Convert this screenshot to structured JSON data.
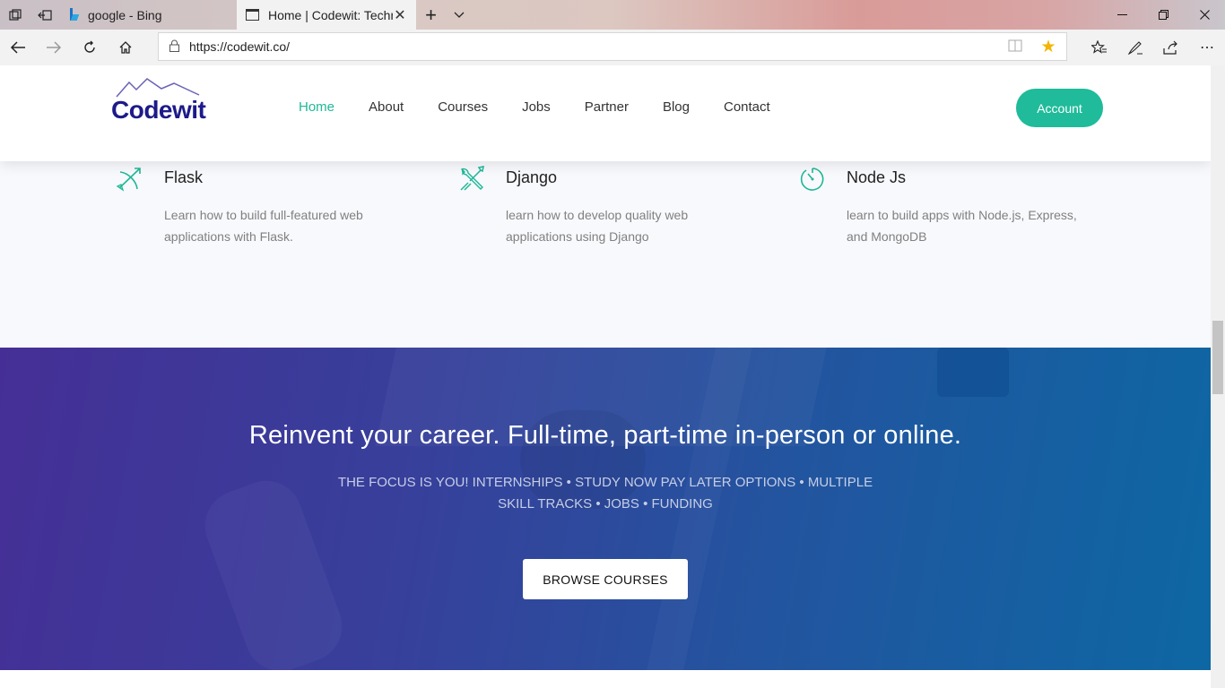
{
  "browser": {
    "tabs": [
      {
        "title": "google - Bing",
        "active": false
      },
      {
        "title": "Home | Codewit: Technology",
        "active": true
      }
    ],
    "url": "https://codewit.co/",
    "favorite_color": "#f4b400"
  },
  "site": {
    "logo_text": "Codewit",
    "menu": [
      {
        "label": "Home",
        "active": true
      },
      {
        "label": "About"
      },
      {
        "label": "Courses"
      },
      {
        "label": "Jobs"
      },
      {
        "label": "Partner"
      },
      {
        "label": "Blog"
      },
      {
        "label": "Contact"
      }
    ],
    "account_label": "Account",
    "accent": "#1fbb9a"
  },
  "features": [
    {
      "icon": "bow-arrow-icon",
      "title": "Flask",
      "desc": "Learn how to build full-featured web applications with Flask."
    },
    {
      "icon": "tools-icon",
      "title": "Django",
      "desc": "learn how to develop quality web applications using Django"
    },
    {
      "icon": "stopwatch-icon",
      "title": "Node Js",
      "desc": "learn to build apps with Node.js, Express, and MongoDB"
    }
  ],
  "hero": {
    "heading": "Reinvent your career. Full-time, part-time in-person or online.",
    "subtext": "THE FOCUS IS YOU! INTERNSHIPS • STUDY NOW PAY LATER OPTIONS • MULTIPLE SKILL TRACKS • JOBS • FUNDING",
    "cta": "BROWSE COURSES"
  }
}
